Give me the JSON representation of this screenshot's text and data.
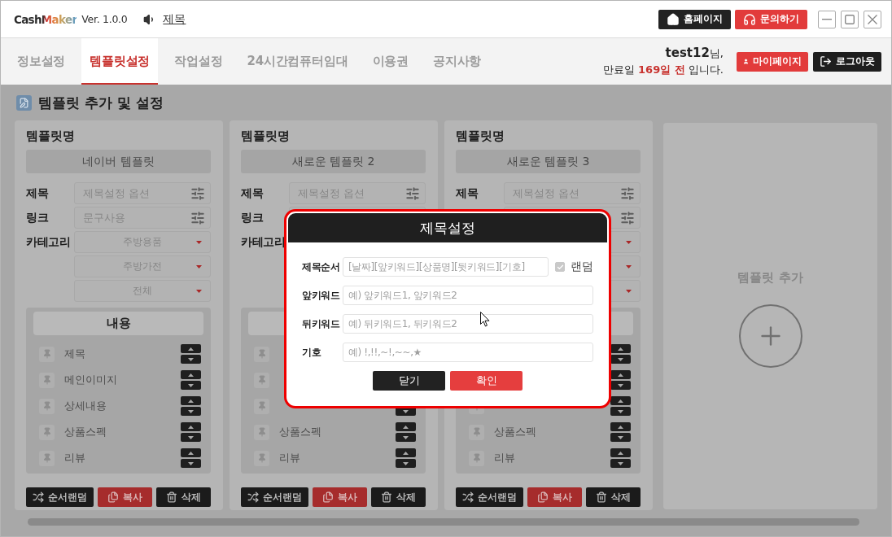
{
  "title_bar": {
    "logo": "CashMaker",
    "version": "Ver. 1.0.0",
    "notice_link": "제목",
    "buttons": [
      {
        "label": "홈페이지",
        "kind": "home"
      },
      {
        "label": "문의하기",
        "kind": "support"
      }
    ]
  },
  "tabs": [
    {
      "label": "정보설정",
      "selected": false
    },
    {
      "label": "템플릿설정",
      "selected": true
    },
    {
      "label": "작업설정",
      "selected": false
    },
    {
      "label": "24시간컴퓨터임대",
      "selected": false
    },
    {
      "label": "이용권",
      "selected": false
    },
    {
      "label": "공지사항",
      "selected": false
    }
  ],
  "user": {
    "greeting": "**test12**님,",
    "expiry": "만료일 **169일 전** 입니다.",
    "buttons": [
      {
        "label": "마이페이지",
        "kind": "mypage"
      },
      {
        "label": "로그아웃",
        "kind": "logout"
      }
    ]
  },
  "section_title": "템플릿 추가 및 설정",
  "cards": [
    {
      "heading": "템플릿명",
      "name": "네이버 템플릿",
      "title_field": {
        "label": "제목",
        "placeholder": "제목설정 옵션"
      },
      "link_field": {
        "label": "링크",
        "placeholder": "문구사용"
      },
      "category_label": "카테고리",
      "categories": [
        "주방용품",
        "주방가전",
        "전체"
      ],
      "content_title": "내용",
      "rows": [
        "제목",
        "메인이미지",
        "상세내용",
        "상품스펙",
        "리뷰"
      ],
      "buttons": [
        {
          "label": "순서랜덤",
          "kind": "shuffle"
        },
        {
          "label": "복사",
          "kind": "copy"
        },
        {
          "label": "삭제",
          "kind": "delete"
        }
      ]
    },
    {
      "heading": "템플릿명",
      "name": "새로운 템플릿 2",
      "title_field": {
        "label": "제목",
        "placeholder": "제목설정 옵션"
      },
      "link_field": {
        "label": "링크"
      },
      "category_label": "카테고리",
      "rows": [
        "상품스펙",
        "리뷰"
      ],
      "buttons": [
        {
          "label": "순서랜덤",
          "kind": "shuffle"
        },
        {
          "label": "복사",
          "kind": "copy"
        },
        {
          "label": "삭제",
          "kind": "delete"
        }
      ]
    },
    {
      "heading": "템플릿명",
      "name": "새로운 템플릿 3",
      "title_field": {
        "label": "제목",
        "placeholder": "제목설정 옵션"
      },
      "rows": [
        "상품스펙",
        "리뷰"
      ],
      "buttons": [
        {
          "label": "순서랜덤",
          "kind": "shuffle"
        },
        {
          "label": "복사",
          "kind": "copy"
        },
        {
          "label": "삭제",
          "kind": "delete"
        }
      ]
    }
  ],
  "add_card": {
    "label": "템플릿 추가"
  },
  "modal": {
    "title": "제목설정",
    "rows": [
      {
        "label": "제목순서",
        "placeholder": "[날짜][앞키워드][상품명][뒷키워드][기호]",
        "option": {
          "label": "랜덤",
          "checked": true,
          "disabled": true
        }
      },
      {
        "label": "앞키워드",
        "placeholder": "예) 앞키워드1, 앞키워드2"
      },
      {
        "label": "뒤키워드",
        "placeholder": "예) 뒤키워드1, 뒤키워드2"
      },
      {
        "label": "기호",
        "placeholder": "예) !,!!,~!,~~,★"
      }
    ],
    "buttons": [
      {
        "label": "닫기",
        "kind": "close"
      },
      {
        "label": "확인",
        "kind": "confirm"
      }
    ]
  }
}
